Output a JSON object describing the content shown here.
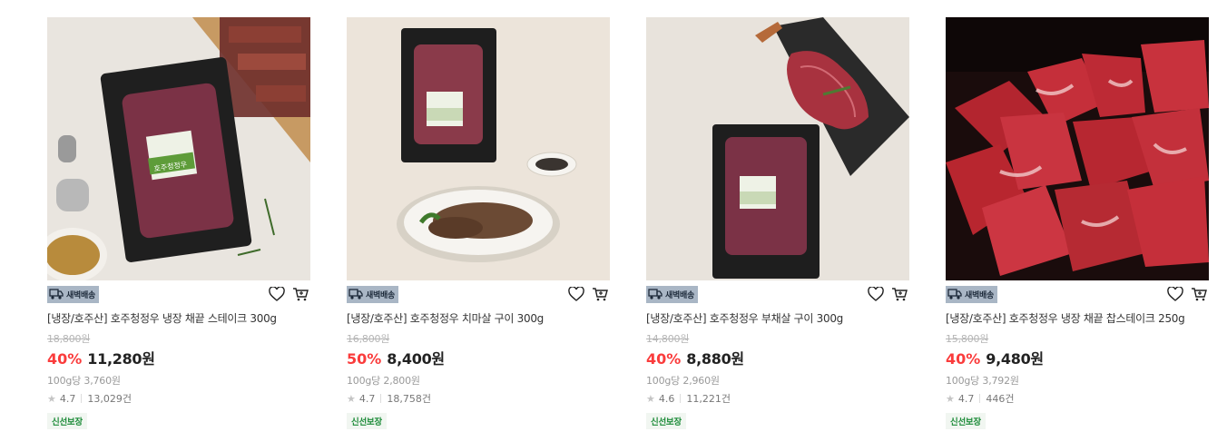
{
  "products": [
    {
      "badge": "새벽배송",
      "title": "[냉장/호주산] 호주청정우 냉장 채끝 스테이크 300g",
      "original_price": "18,800원",
      "discount": "40%",
      "price": "11,280원",
      "unit_price": "100g당 3,760원",
      "rating": "4.7",
      "reviews": "13,029건",
      "tag": "신선보장"
    },
    {
      "badge": "새벽배송",
      "title": "[냉장/호주산] 호주청정우 치마살 구이 300g",
      "original_price": "16,800원",
      "discount": "50%",
      "price": "8,400원",
      "unit_price": "100g당 2,800원",
      "rating": "4.7",
      "reviews": "18,758건",
      "tag": "신선보장"
    },
    {
      "badge": "새벽배송",
      "title": "[냉장/호주산] 호주청정우 부채살 구이 300g",
      "original_price": "14,800원",
      "discount": "40%",
      "price": "8,880원",
      "unit_price": "100g당 2,960원",
      "rating": "4.6",
      "reviews": "11,221건",
      "tag": "신선보장"
    },
    {
      "badge": "새벽배송",
      "title": "[냉장/호주산] 호주청정우 냉장 채끝 찹스테이크 250g",
      "original_price": "15,800원",
      "discount": "40%",
      "price": "9,480원",
      "unit_price": "100g당 3,792원",
      "rating": "4.7",
      "reviews": "446건",
      "tag": "신선보장"
    }
  ],
  "icons": {
    "badge": "delivery-truck-icon",
    "wish": "heart-icon",
    "cart": "cart-icon",
    "rating": "star-icon"
  },
  "colors": {
    "discount": "#fa3c3c",
    "badge_bg": "#a9b6c5",
    "fresh_text": "#1e8c3a"
  },
  "images": {
    "label_text": "호주청정우"
  }
}
